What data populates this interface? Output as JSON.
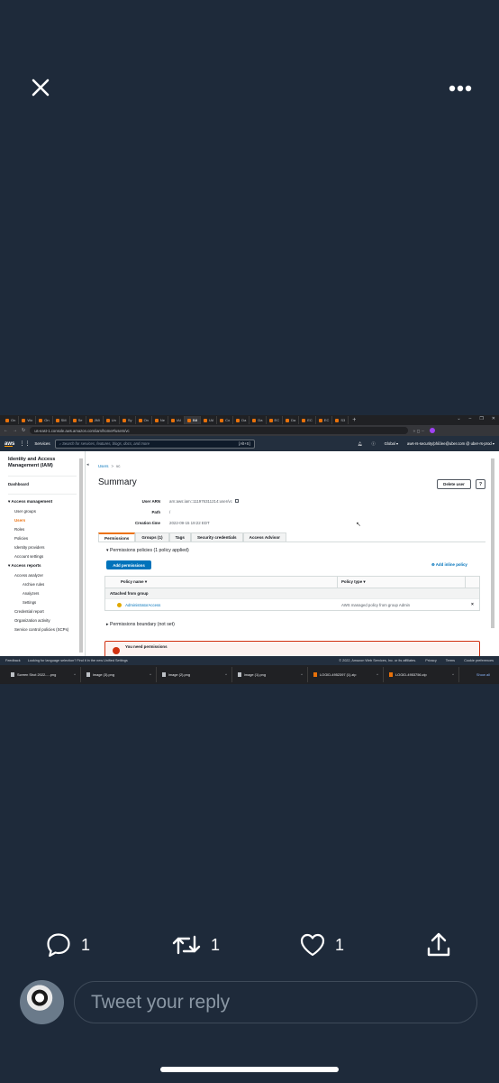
{
  "viewer": {
    "close_icon": "close-icon",
    "more_icon": "more-horizontal-icon"
  },
  "browser": {
    "tabs": [
      "On",
      "Wo",
      "On",
      "SM",
      "Se",
      "JMi",
      "Un",
      "Sy",
      "On",
      "Ne",
      "IAI",
      "Bill",
      "IAI",
      "Co",
      "Da",
      "Da",
      "EC",
      "Da",
      "EC",
      "EC",
      "S3"
    ],
    "url": "us-east-1.console.aws.amazon.com/iam/home#/users/vc"
  },
  "aws_header": {
    "logo": "aws",
    "services": "Services",
    "search_placeholder": "Search for services, features, blogs, docs, and more",
    "search_shortcut": "[Alt+S]",
    "region": "Global ▾",
    "account": "aws-rs-security/phil.lee@uber.com @ uber-rs-prod ▾"
  },
  "left_nav": {
    "title": "Identity and Access Management (IAM)",
    "dashboard": "Dashboard",
    "access_management": "Access management",
    "user_groups": "User groups",
    "users": "Users",
    "roles": "Roles",
    "policies": "Policies",
    "identity_providers": "Identity providers",
    "account_settings": "Account settings",
    "access_reports": "Access reports",
    "access_analyzer": "Access analyzer",
    "archive_rules": "Archive rules",
    "analyzers": "Analyzers",
    "settings": "Settings",
    "credential_report": "Credential report",
    "org_activity": "Organization activity",
    "scp": "Service control policies (SCPs)"
  },
  "main": {
    "breadcrumb_users": "Users",
    "breadcrumb_sep": ">",
    "breadcrumb_current": "vc",
    "title": "Summary",
    "delete_user": "Delete user",
    "help": "?",
    "user_arn_label": "User ARN",
    "user_arn": "arn:aws:iam::111976311214:user/vc",
    "path_label": "Path",
    "path": "/",
    "creation_label": "Creation time",
    "creation": "2022-09-15 19:22 EDT",
    "tabs": [
      "Permissions",
      "Groups (1)",
      "Tags",
      "Security credentials",
      "Access Advisor"
    ],
    "permissions_policies": "Permissions policies (1 policy applied)",
    "add_permissions": "Add permissions",
    "add_inline": "Add inline policy",
    "col_policy_name": "Policy name ▾",
    "col_policy_type": "Policy type ▾",
    "attached_from_group": "Attached from group",
    "policy_name": "AdministratorAccess",
    "policy_type": "AWS managed policy from group Admin",
    "remove": "×",
    "boundary": "Permissions boundary (not set)",
    "need_permissions": "You need permissions"
  },
  "aws_footer": {
    "feedback": "Feedback",
    "lang": "Looking for language selection? Find it in the new Unified Settings",
    "copyright": "© 2022, Amazon Web Services, Inc. or its affiliates.",
    "privacy": "Privacy",
    "terms": "Terms",
    "cookies": "Cookie preferences"
  },
  "downloads": {
    "items": [
      "Screen Shot 2022-....png",
      "image (3).png",
      "image (2).png",
      "image (1).png",
      "LOGID-4952397 (1).zip",
      "LOGID-4953756.zip"
    ],
    "show_all": "Show all"
  },
  "tweet_actions": {
    "reply_count": "1",
    "retweet_count": "1",
    "like_count": "1"
  },
  "reply_box": {
    "placeholder": "Tweet your reply"
  }
}
